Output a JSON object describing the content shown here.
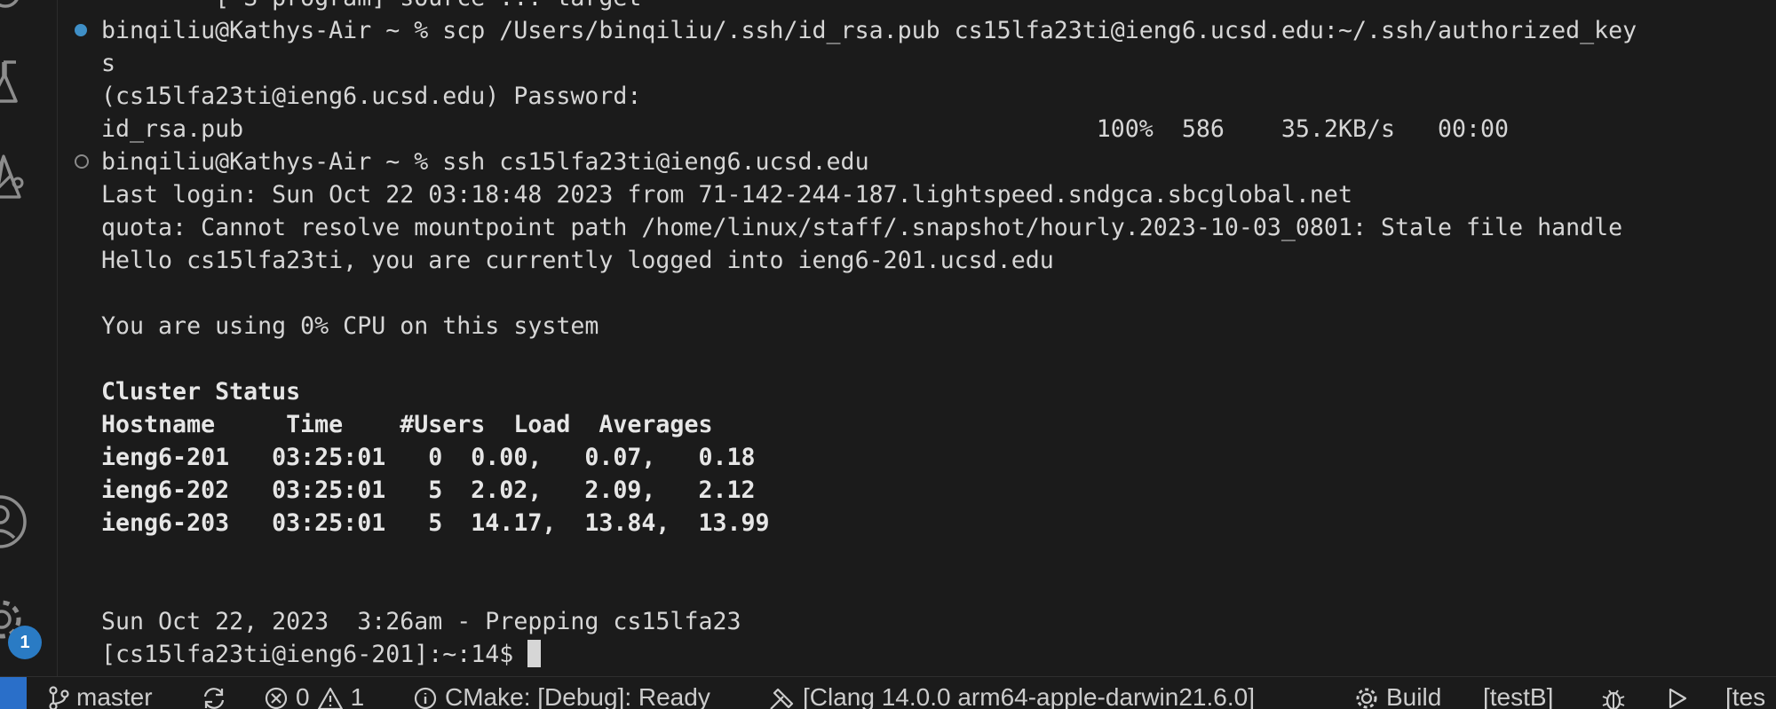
{
  "activity_bar": {
    "icons": [
      "search-icon",
      "flask-icon",
      "cmake-icon",
      "account-icon",
      "settings-gear-icon"
    ],
    "settings_badge": "1"
  },
  "terminal": {
    "lines": [
      {
        "text": "        [-S program] source ... target"
      },
      {
        "text": "binqiliu@Kathys-Air ~ % scp /Users/binqiliu/.ssh/id_rsa.pub cs15lfa23ti@ieng6.ucsd.edu:~/.ssh/authorized_key"
      },
      {
        "text": "s"
      },
      {
        "text": "(cs15lfa23ti@ieng6.ucsd.edu) Password:"
      },
      {
        "text": "id_rsa.pub                                                            100%  586    35.2KB/s   00:00"
      },
      {
        "text": "binqiliu@Kathys-Air ~ % ssh cs15lfa23ti@ieng6.ucsd.edu"
      },
      {
        "text": "Last login: Sun Oct 22 03:18:48 2023 from 71-142-244-187.lightspeed.sndgca.sbcglobal.net"
      },
      {
        "text": "quota: Cannot resolve mountpoint path /home/linux/staff/.snapshot/hourly.2023-10-03_0801: Stale file handle"
      },
      {
        "text": "Hello cs15lfa23ti, you are currently logged into ieng6-201.ucsd.edu"
      },
      {
        "text": ""
      },
      {
        "text": "You are using 0% CPU on this system"
      },
      {
        "text": ""
      },
      {
        "text": "Cluster Status"
      },
      {
        "text": "Hostname     Time    #Users  Load  Averages"
      },
      {
        "text": "ieng6-201   03:25:01   0  0.00,   0.07,   0.18"
      },
      {
        "text": "ieng6-202   03:25:01   5  2.02,   2.09,   2.12"
      },
      {
        "text": "ieng6-203   03:25:01   5  14.17,  13.84,  13.99"
      },
      {
        "text": ""
      },
      {
        "text": ""
      },
      {
        "text": "Sun Oct 22, 2023  3:26am - Prepping cs15lfa23"
      },
      {
        "text": "[cs15lfa23ti@ieng6-201]:~:14$ "
      }
    ],
    "command_marks": [
      {
        "line": 1,
        "state": "success"
      },
      {
        "line": 5,
        "state": "running"
      }
    ]
  },
  "status_bar": {
    "branch": "master",
    "errors": "0",
    "warnings": "1",
    "cmake": "CMake: [Debug]: Ready",
    "kit": "[Clang 14.0.0 arm64-apple-darwin21.6.0]",
    "build": "Build",
    "target": "[testB]",
    "test_target": "[tes"
  }
}
